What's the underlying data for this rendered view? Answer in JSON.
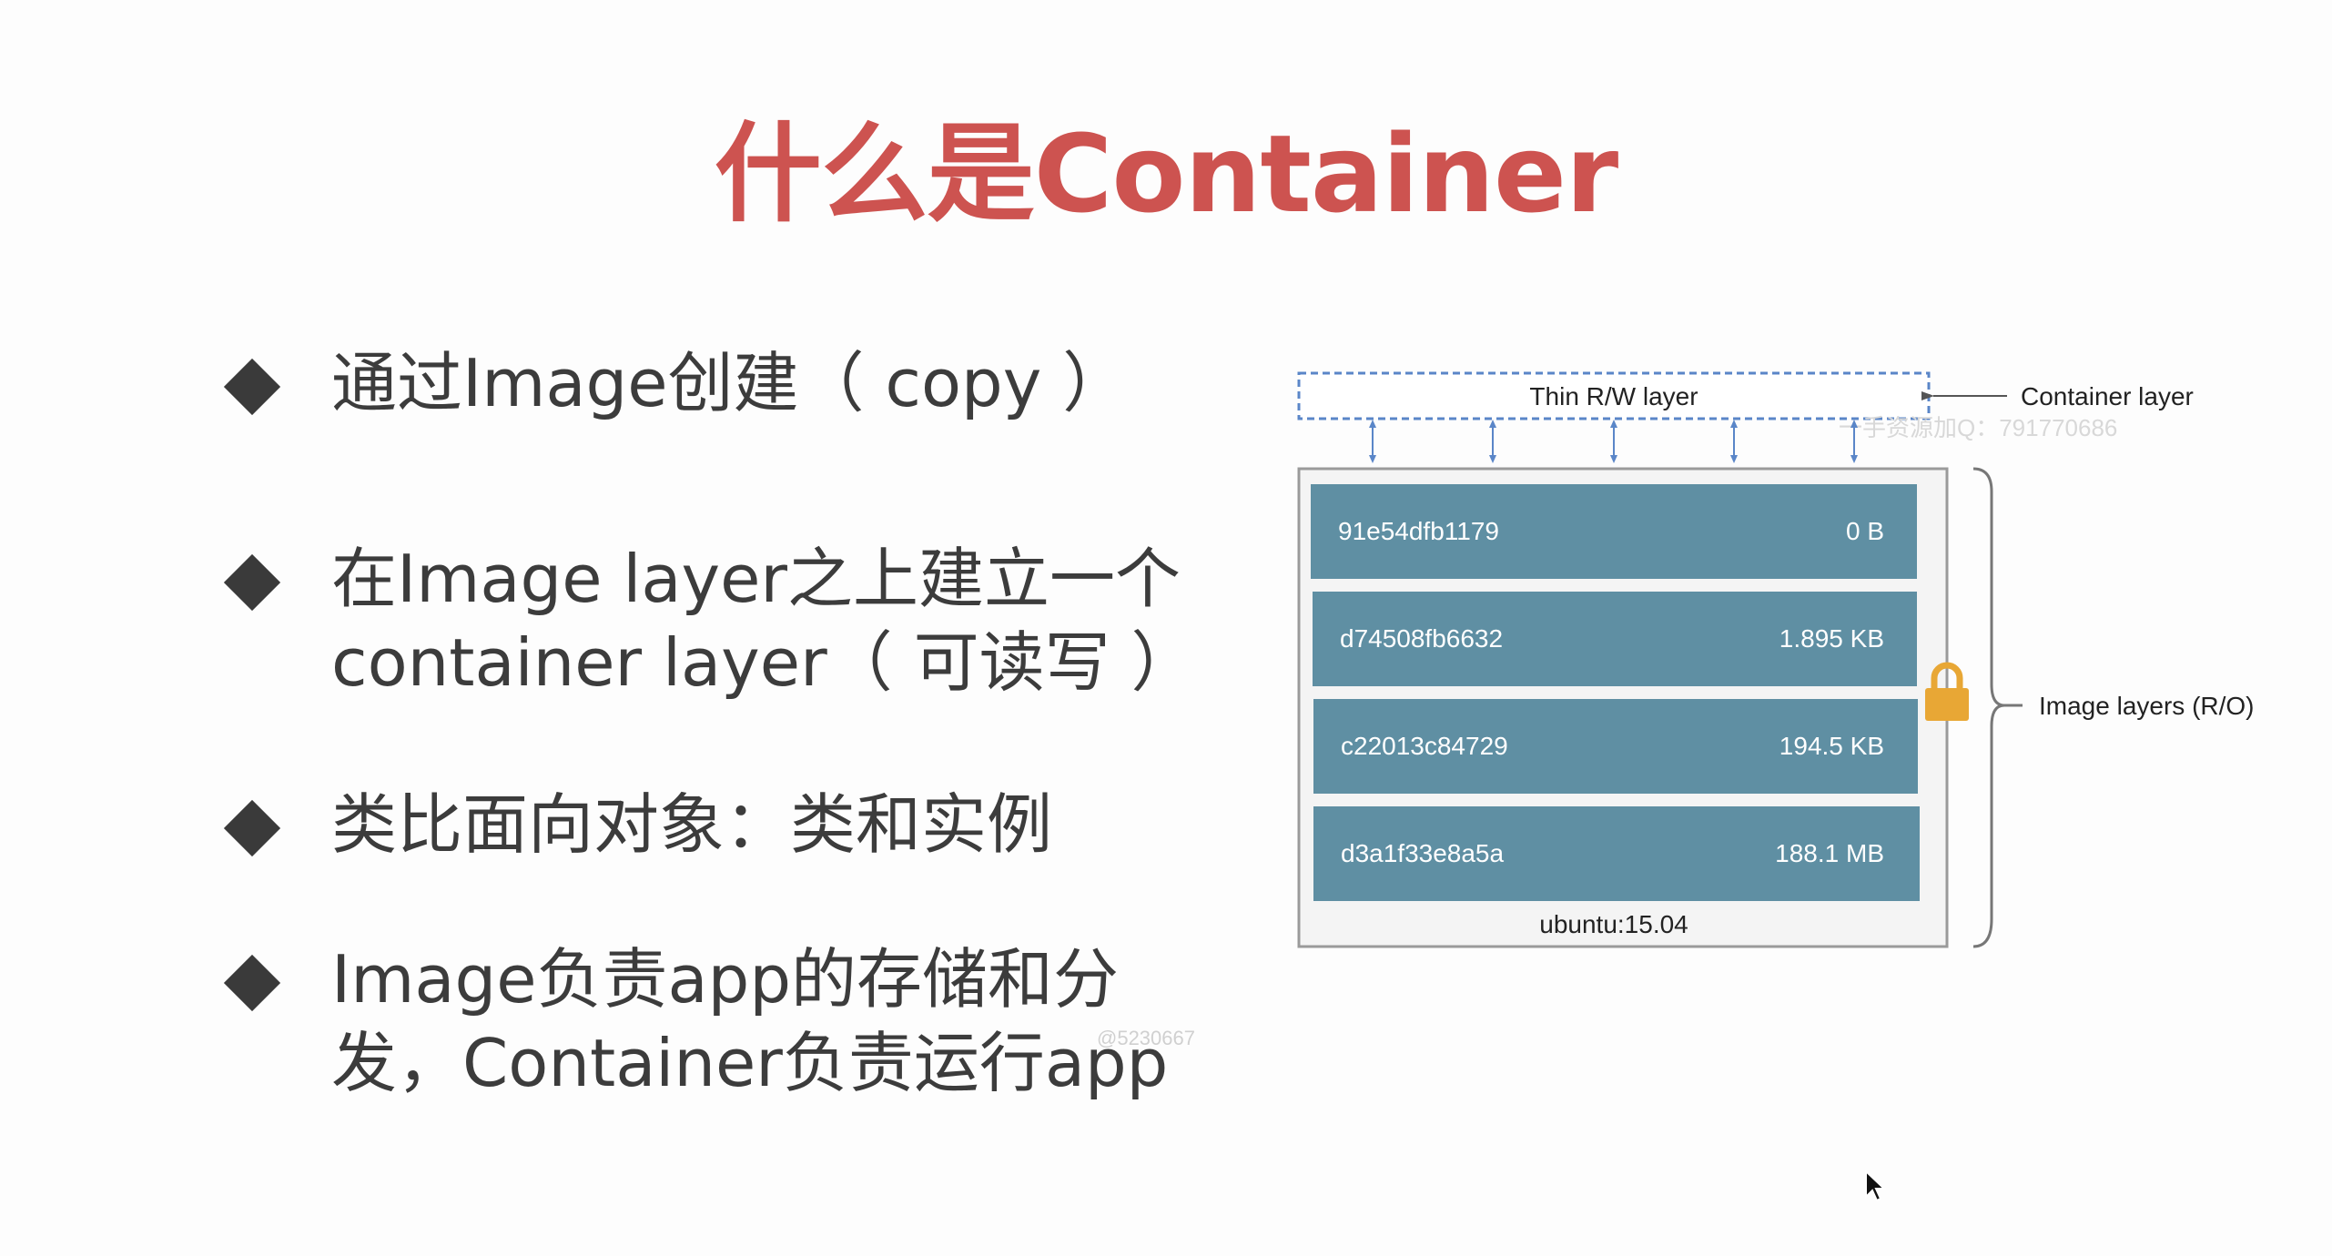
{
  "slide": {
    "title": "什么是Container",
    "bullets": [
      {
        "lines": [
          "通过Image创建（ copy ）"
        ]
      },
      {
        "lines": [
          "在Image layer之上建立一个",
          "container layer（ 可读写 ）"
        ]
      },
      {
        "lines": [
          "类比面向对象：类和实例"
        ]
      },
      {
        "lines": [
          "Image负责app的存储和分",
          "发，Container负责运行app"
        ]
      }
    ]
  },
  "diagram": {
    "thin_layer_label": "Thin R/W layer",
    "container_layer_label": "Container layer",
    "image_layers_label": "Image layers (R/O)",
    "base_image_label": "ubuntu:15.04",
    "layers": [
      {
        "id": "91e54dfb1179",
        "size": "0 B"
      },
      {
        "id": "d74508fb6632",
        "size": "1.895 KB"
      },
      {
        "id": "c22013c84729",
        "size": "194.5 KB"
      },
      {
        "id": "d3a1f33e8a5a",
        "size": "188.1 MB"
      }
    ],
    "colors": {
      "layer_fill": "#5f8fa3",
      "dashed_border": "#5a86c8",
      "arrow": "#5a86c8",
      "lock": "#e8a735"
    }
  },
  "watermarks": {
    "qq": "一手资源加Q：791770686",
    "id": "@5230667"
  }
}
